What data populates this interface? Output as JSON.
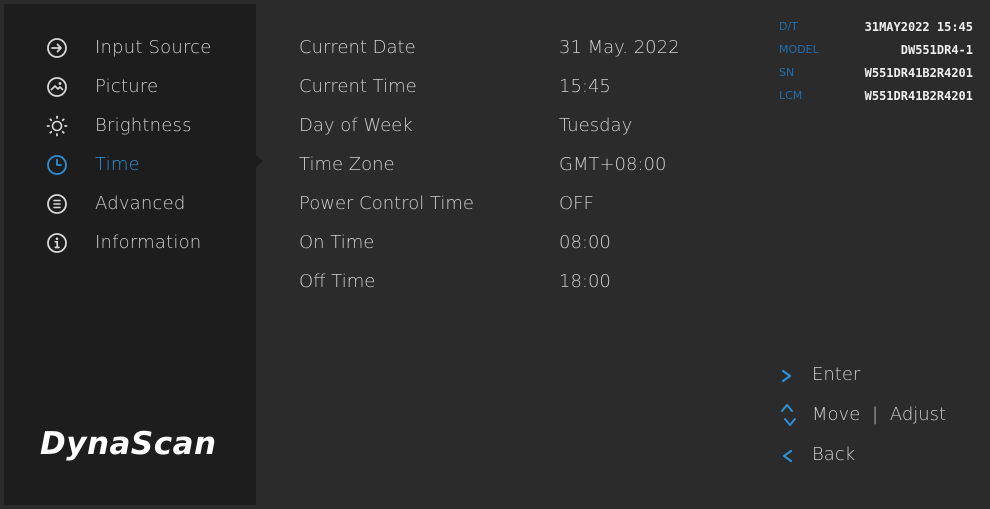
{
  "menu": {
    "items": [
      {
        "label": "Input Source",
        "icon": "input-source-icon"
      },
      {
        "label": "Picture",
        "icon": "picture-icon"
      },
      {
        "label": "Brightness",
        "icon": "brightness-icon"
      },
      {
        "label": "Time",
        "icon": "time-icon",
        "active": true
      },
      {
        "label": "Advanced",
        "icon": "advanced-icon"
      },
      {
        "label": "Information",
        "icon": "information-icon"
      }
    ],
    "active_color": "#2f8fd8"
  },
  "brand": {
    "logo_text": "DynaScan"
  },
  "settings": {
    "rows": [
      {
        "label": "Current Date",
        "value": "31 May. 2022"
      },
      {
        "label": "Current Time",
        "value": "15:45"
      },
      {
        "label": "Day of Week",
        "value": "Tuesday"
      },
      {
        "label": "Time Zone",
        "value": "GMT+08:00"
      },
      {
        "label": "Power Control Time",
        "value": "OFF"
      },
      {
        "label": "On Time",
        "value": "08:00"
      },
      {
        "label": "Off Time",
        "value": "18:00"
      }
    ]
  },
  "device_info": {
    "rows": [
      {
        "label": "D/T",
        "value": "31MAY2022 15:45"
      },
      {
        "label": "MODEL",
        "value": "DW551DR4-1"
      },
      {
        "label": "SN",
        "value": "W551DR41B2R4201"
      },
      {
        "label": "LCM",
        "value": "W551DR41B2R4201"
      }
    ]
  },
  "hints": {
    "enter": "Enter",
    "move": "Move",
    "separator": "|",
    "adjust": "Adjust",
    "back": "Back"
  }
}
